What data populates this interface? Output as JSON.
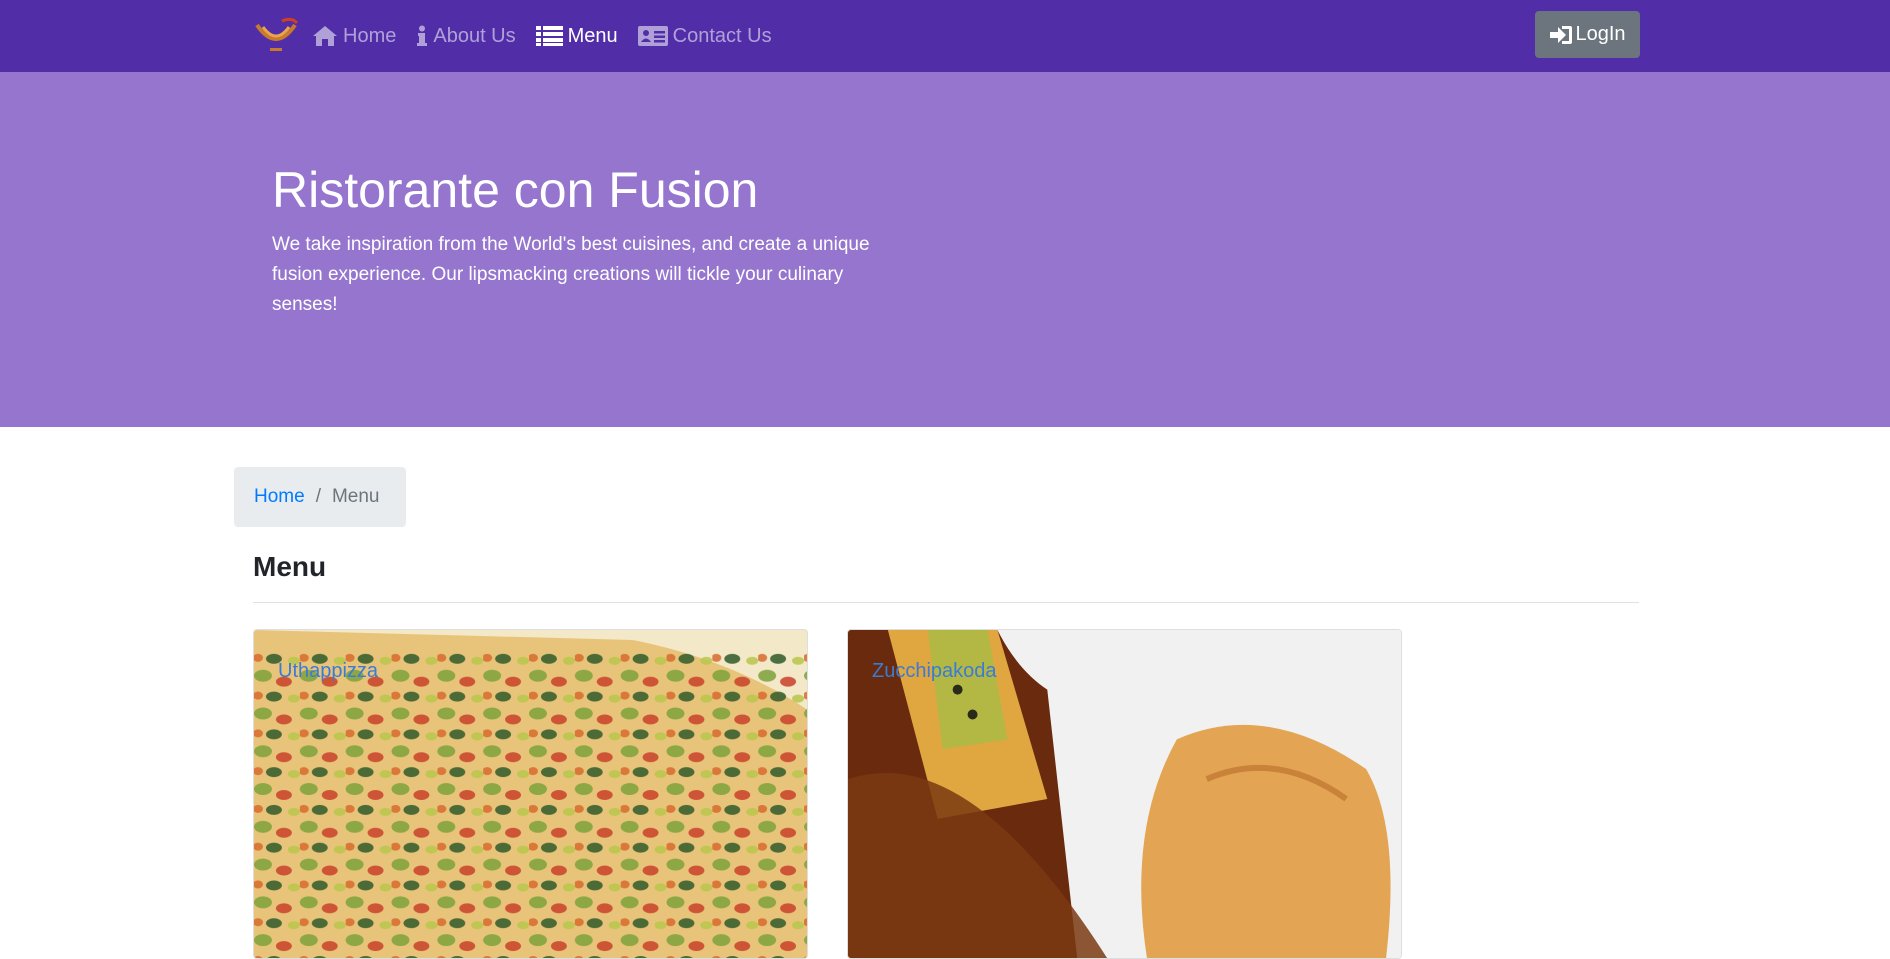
{
  "nav": {
    "logo": "restaurant-logo",
    "items": [
      {
        "label": "Home",
        "icon": "home-icon",
        "active": false
      },
      {
        "label": "About Us",
        "icon": "info-icon",
        "active": false
      },
      {
        "label": "Menu",
        "icon": "list-icon",
        "active": true
      },
      {
        "label": "Contact Us",
        "icon": "address-card-icon",
        "active": false
      }
    ],
    "login_label": "LogIn",
    "login_icon": "sign-in-icon"
  },
  "hero": {
    "title": "Ristorante con Fusion",
    "text": "We take inspiration from the World's best cuisines, and create a unique fusion experience. Our lipsmacking creations will tickle your culinary senses!"
  },
  "breadcrumb": {
    "items": [
      {
        "label": "Home"
      },
      {
        "label": "Menu"
      }
    ]
  },
  "page": {
    "title": "Menu"
  },
  "dishes": [
    {
      "name": "Uthappizza",
      "image": "pizza-photo"
    },
    {
      "name": "Zucchipakoda",
      "image": "pakoda-photo"
    }
  ],
  "colors": {
    "navbar": "#512DA8",
    "jumbotron": "#9575CD",
    "link": "#007bff",
    "button": "#6c757d"
  }
}
